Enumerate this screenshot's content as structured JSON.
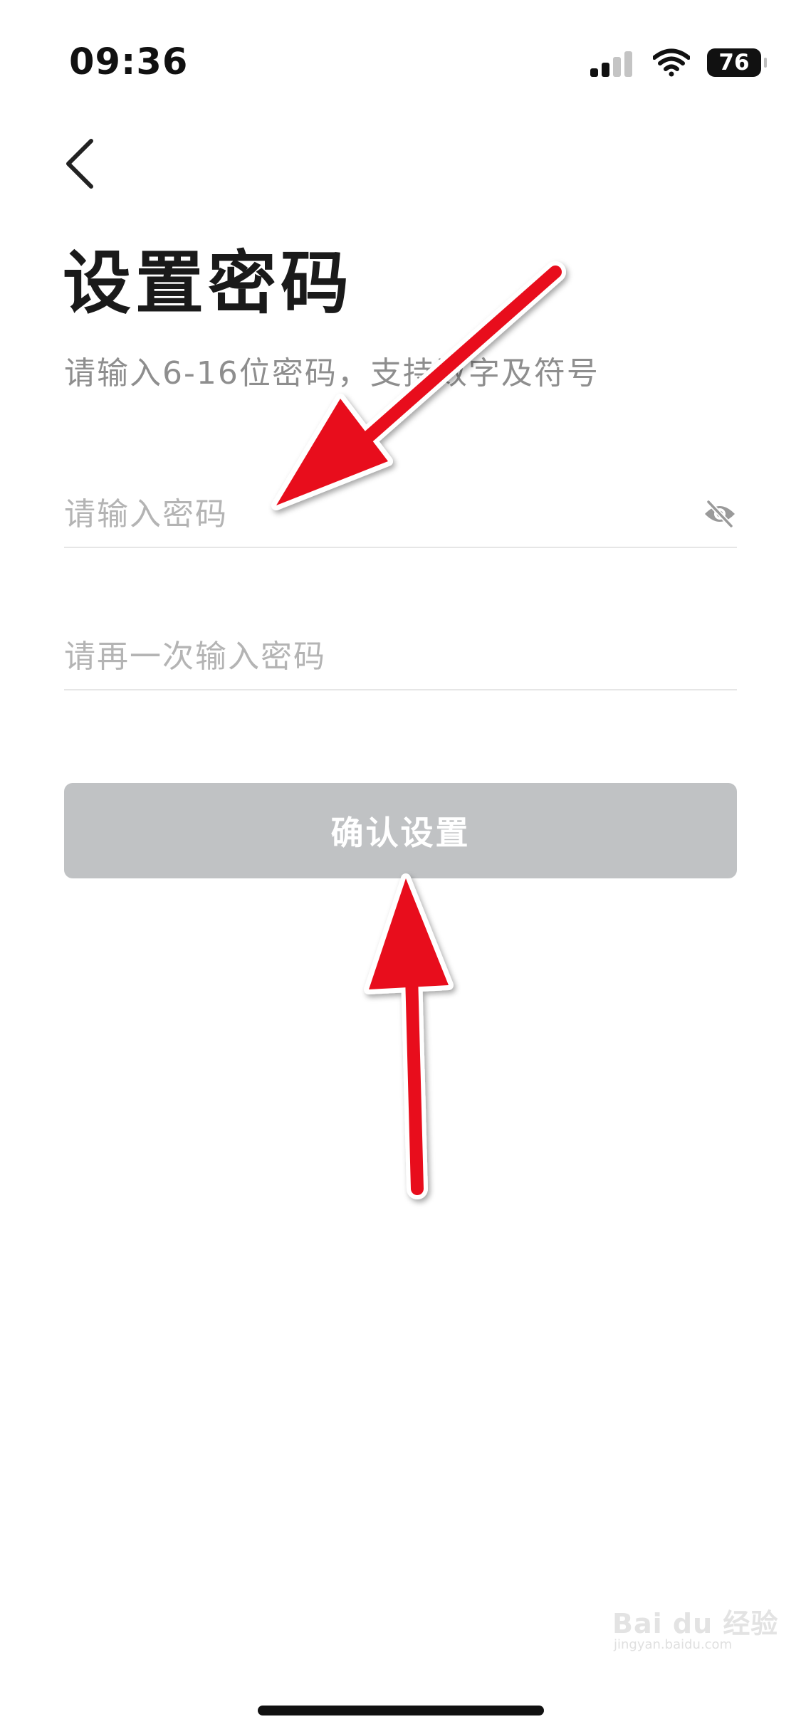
{
  "status_bar": {
    "time": "09:36",
    "battery": "76",
    "signal_icon": "cellular-signal-icon",
    "wifi_icon": "wifi-icon"
  },
  "nav": {
    "back_icon": "chevron-left-icon"
  },
  "header": {
    "title": "设置密码",
    "subtitle": "请输入6-16位密码，支持数字及符号"
  },
  "form": {
    "password_placeholder": "请输入密码",
    "password_value": "",
    "confirm_placeholder": "请再一次输入密码",
    "confirm_value": "",
    "visibility_icon": "eye-hidden-icon",
    "submit_label": "确认设置",
    "submit_color": "#c0c2c4"
  },
  "annotations": {
    "arrow_color": "#e8101a"
  },
  "watermark": {
    "text": "Bai du 经验",
    "url": "jingyan.baidu.com"
  }
}
